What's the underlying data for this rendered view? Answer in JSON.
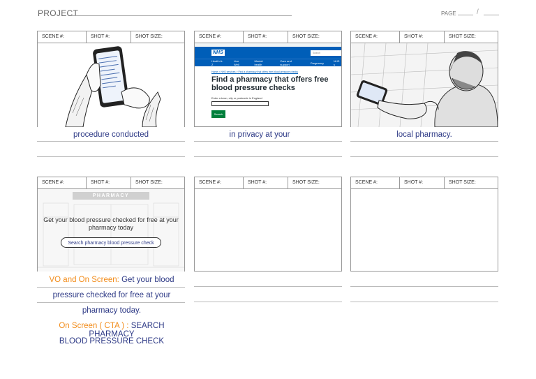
{
  "header": {
    "project_label": "PROJECT",
    "page_label": "PAGE",
    "page_separator": "/"
  },
  "frame_labels": {
    "scene": "SCENE #:",
    "shot": "SHOT #:",
    "shot_size": "SHOT SIZE:"
  },
  "frames": [
    {
      "caption": "procedure conducted"
    },
    {
      "caption": "in privacy at your"
    },
    {
      "caption": "local pharmacy."
    },
    {
      "caption": ""
    },
    {
      "caption": ""
    },
    {
      "caption": ""
    }
  ],
  "nhs_page": {
    "logo": "NHS",
    "search_placeholder": "Search",
    "nav": [
      "Health A-Z",
      "Live Well",
      "Mental health",
      "Care and support",
      "Pregnancy",
      "NHS s"
    ],
    "breadcrumb": "Home  >  NHS services  >  Find a pharmacy that offers free blood pressure checks",
    "heading": "Find a pharmacy that offers free blood pressure checks",
    "input_label": "Enter a town, city or postcode in England",
    "search_button": "Search"
  },
  "pharmacy_cta": {
    "sign": "PHARMACY",
    "text": "Get your blood pressure checked for free at your pharmacy today",
    "button": "Search pharmacy blood pressure check"
  },
  "script_lines": {
    "vo_label": "VO and On Screen:",
    "vo_text_1": "Get your blood",
    "vo_text_2": "pressure checked for free at your",
    "vo_text_3": "pharmacy today.",
    "cta_label": "On Screen ( CTA ) :",
    "cta_text_1": "SEARCH PHARMACY",
    "cta_text_2": "BLOOD PRESSURE CHECK"
  },
  "colors": {
    "caption": "#2e3a86",
    "label_orange": "#f28c1a",
    "nhs_blue": "#005eb8",
    "nhs_green": "#007f3b"
  }
}
